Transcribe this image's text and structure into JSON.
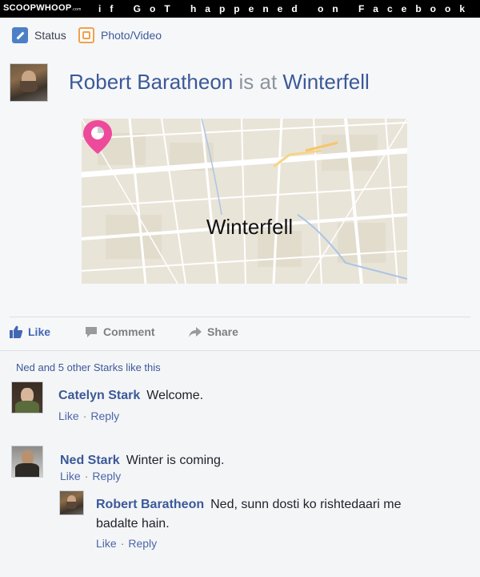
{
  "header": {
    "brand": "SCOOPWHOOP",
    "brand_suffix": ".com",
    "headline": "if GoT happened on Facebook"
  },
  "composer": {
    "status_label": "Status",
    "photo_label": "Photo/Video"
  },
  "post": {
    "author": "Robert Baratheon",
    "connector": "is at",
    "place": "Winterfell",
    "map_label": "Winterfell",
    "pin_color": "#ee4a9b"
  },
  "actions": {
    "like": "Like",
    "comment": "Comment",
    "share": "Share"
  },
  "likes_summary": "Ned and 5 other Starks like this",
  "comments": [
    {
      "author": "Catelyn Stark",
      "text": "Welcome.",
      "like": "Like",
      "reply": "Reply"
    },
    {
      "author": "Ned Stark",
      "text": "Winter is coming.",
      "like": "Like",
      "reply": "Reply"
    },
    {
      "author": "Robert Baratheon",
      "text": "Ned, sunn dosti ko rishtedaari me badalte hain.",
      "like": "Like",
      "reply": "Reply"
    }
  ],
  "colors": {
    "link_blue": "#3b5998",
    "like_blue": "#4267b2",
    "action_gray": "#7f7f7f"
  }
}
